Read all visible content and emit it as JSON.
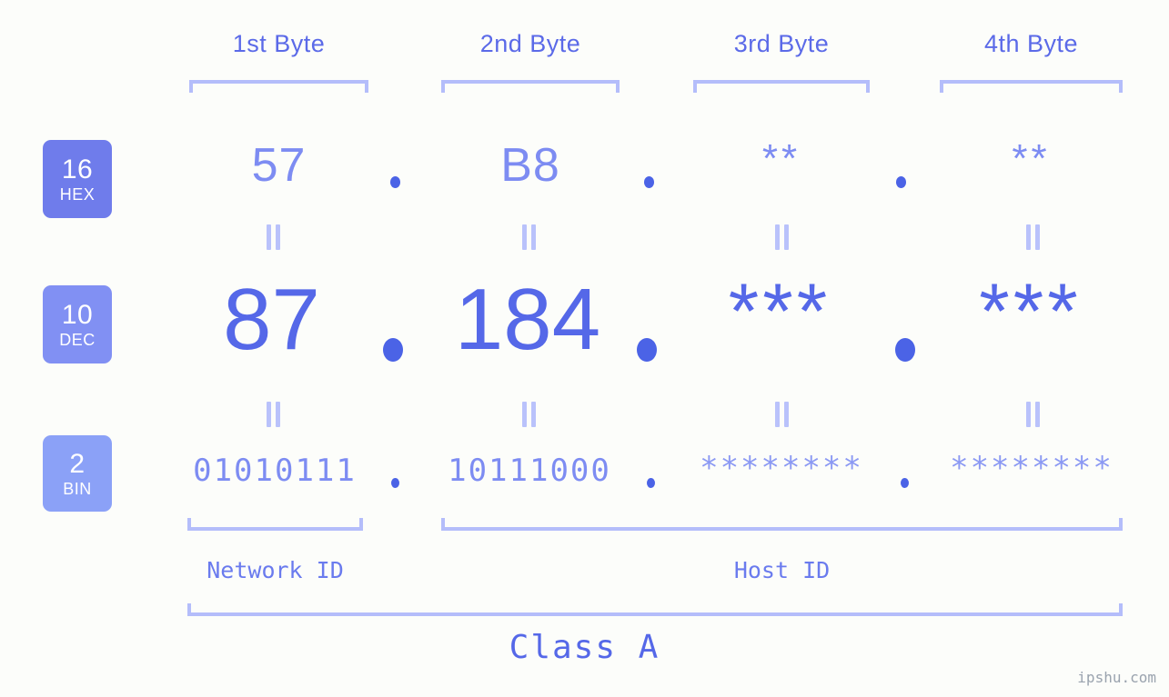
{
  "meta": {
    "watermark": "ipshu.com",
    "background_color": "#fcfdfa",
    "accent_color": "#5568e8",
    "light_accent_color": "#b4bdfa"
  },
  "byte_headers": [
    {
      "label": "1st Byte"
    },
    {
      "label": "2nd Byte"
    },
    {
      "label": "3rd Byte"
    },
    {
      "label": "4th Byte"
    }
  ],
  "bases": [
    {
      "num": "16",
      "name": "HEX",
      "color": "#6f7ceb"
    },
    {
      "num": "10",
      "name": "DEC",
      "color": "#8190f3"
    },
    {
      "num": "2",
      "name": "BIN",
      "color": "#8ba1f7"
    }
  ],
  "rows": {
    "hex": {
      "base_label": "HEX",
      "values": [
        "57",
        "B8",
        "**",
        "**"
      ],
      "separator": "."
    },
    "dec": {
      "base_label": "DEC",
      "values": [
        "87",
        "184",
        "***",
        "***"
      ],
      "separator": "."
    },
    "bin": {
      "base_label": "BIN",
      "values": [
        "01010111",
        "10111000",
        "********",
        "********"
      ],
      "separator": "."
    }
  },
  "equivalence_mark": "=",
  "id_labels": {
    "network": "Network ID",
    "host": "Host ID"
  },
  "class_label": "Class A"
}
